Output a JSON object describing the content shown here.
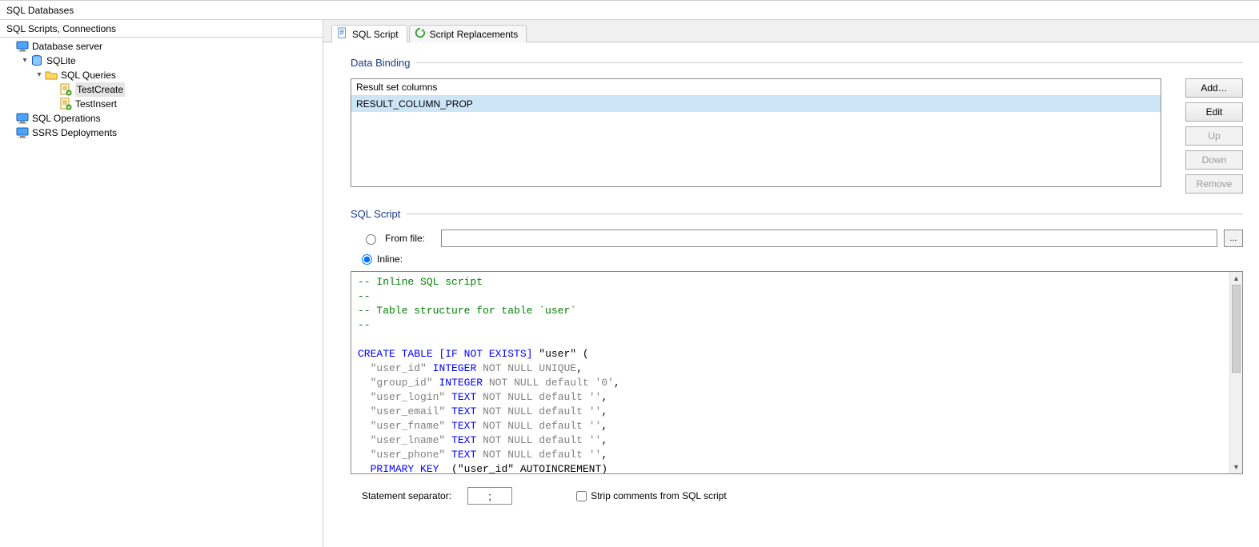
{
  "window": {
    "title": "SQL Databases"
  },
  "left": {
    "subtitle": "SQL Scripts, Connections",
    "tree": [
      {
        "id": "dbserver",
        "label": "Database server",
        "depth": 0,
        "icon": "monitor",
        "twisty": "none",
        "selected": false
      },
      {
        "id": "sqlite",
        "label": "SQLite",
        "depth": 1,
        "icon": "db",
        "twisty": "open",
        "selected": false
      },
      {
        "id": "sqlq",
        "label": "SQL Queries",
        "depth": 2,
        "icon": "folder",
        "twisty": "open",
        "selected": false
      },
      {
        "id": "tc",
        "label": "TestCreate",
        "depth": 3,
        "icon": "script",
        "twisty": "none",
        "selected": true
      },
      {
        "id": "ti",
        "label": "TestInsert",
        "depth": 3,
        "icon": "script",
        "twisty": "none",
        "selected": false
      },
      {
        "id": "sqlops",
        "label": "SQL Operations",
        "depth": 0,
        "icon": "monitor",
        "twisty": "none",
        "selected": false
      },
      {
        "id": "ssrs",
        "label": "SSRS Deployments",
        "depth": 0,
        "icon": "monitor",
        "twisty": "none",
        "selected": false
      }
    ]
  },
  "tabs": [
    {
      "id": "sqlscript",
      "label": "SQL Script",
      "icon": "doc",
      "active": true
    },
    {
      "id": "screpl",
      "label": "Script Replacements",
      "icon": "refresh",
      "active": false
    }
  ],
  "data_binding": {
    "title": "Data Binding",
    "header": "Result set columns",
    "items": [
      "RESULT_COLUMN_PROP"
    ],
    "selected_index": 0,
    "buttons": {
      "add": {
        "label": "Add…",
        "enabled": true
      },
      "edit": {
        "label": "Edit",
        "enabled": true
      },
      "up": {
        "label": "Up",
        "enabled": false
      },
      "down": {
        "label": "Down",
        "enabled": false
      },
      "remove": {
        "label": "Remove",
        "enabled": false
      }
    }
  },
  "sql_script": {
    "title": "SQL Script",
    "from_file_label": "From file:",
    "inline_label": "Inline:",
    "selected_source": "inline",
    "file_path": "",
    "browse_label": "...",
    "statement_separator_label": "Statement separator:",
    "statement_separator_value": ";",
    "strip_comments_label": "Strip comments from SQL script",
    "strip_comments_checked": false,
    "code_lines": [
      {
        "t": "comment",
        "text": "-- Inline SQL script"
      },
      {
        "t": "comment",
        "text": "--"
      },
      {
        "t": "comment",
        "text": "-- Table structure for table `user`"
      },
      {
        "t": "comment",
        "text": "--"
      },
      {
        "t": "blank",
        "text": ""
      },
      {
        "t": "create",
        "kw": "CREATE TABLE",
        "opt": "[IF NOT EXISTS]",
        "tail": " \"user\" ("
      },
      {
        "t": "col",
        "name": "\"user_id\"",
        "type": "INTEGER",
        "rest": "NOT NULL UNIQUE",
        "tail": ","
      },
      {
        "t": "col",
        "name": "\"group_id\"",
        "type": "INTEGER",
        "rest": "NOT NULL default '0'",
        "tail": ","
      },
      {
        "t": "col",
        "name": "\"user_login\"",
        "type": "TEXT",
        "rest": "NOT NULL default ''",
        "tail": ","
      },
      {
        "t": "col",
        "name": "\"user_email\"",
        "type": "TEXT",
        "rest": "NOT NULL default ''",
        "tail": ","
      },
      {
        "t": "col",
        "name": "\"user_fname\"",
        "type": "TEXT",
        "rest": "NOT NULL default ''",
        "tail": ","
      },
      {
        "t": "col",
        "name": "\"user_lname\"",
        "type": "TEXT",
        "rest": "NOT NULL default ''",
        "tail": ","
      },
      {
        "t": "col",
        "name": "\"user_phone\"",
        "type": "TEXT",
        "rest": "NOT NULL default ''",
        "tail": ","
      },
      {
        "t": "pk",
        "kw": "PRIMARY KEY",
        "body": "  (\"user_id\" AUTOINCREMENT)"
      }
    ]
  }
}
